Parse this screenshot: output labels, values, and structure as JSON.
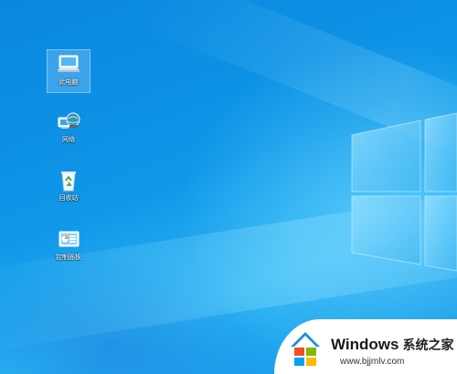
{
  "desktop": {
    "icons": [
      {
        "label": "此电脑",
        "icon": "computer-icon",
        "selected": true
      },
      {
        "label": "网络",
        "icon": "network-icon",
        "selected": false
      },
      {
        "label": "回收站",
        "icon": "recycle-bin-icon",
        "selected": false
      },
      {
        "label": "控制面板",
        "icon": "control-panel-icon",
        "selected": false
      }
    ]
  },
  "watermark": {
    "brand": "Windows",
    "brand_cn": "系统之家",
    "url": "www.bjjmlv.com"
  },
  "colors": {
    "desktop_blue": "#0f97e8",
    "logo_light": "#7fd6ff",
    "selection": "#cce8ff"
  }
}
